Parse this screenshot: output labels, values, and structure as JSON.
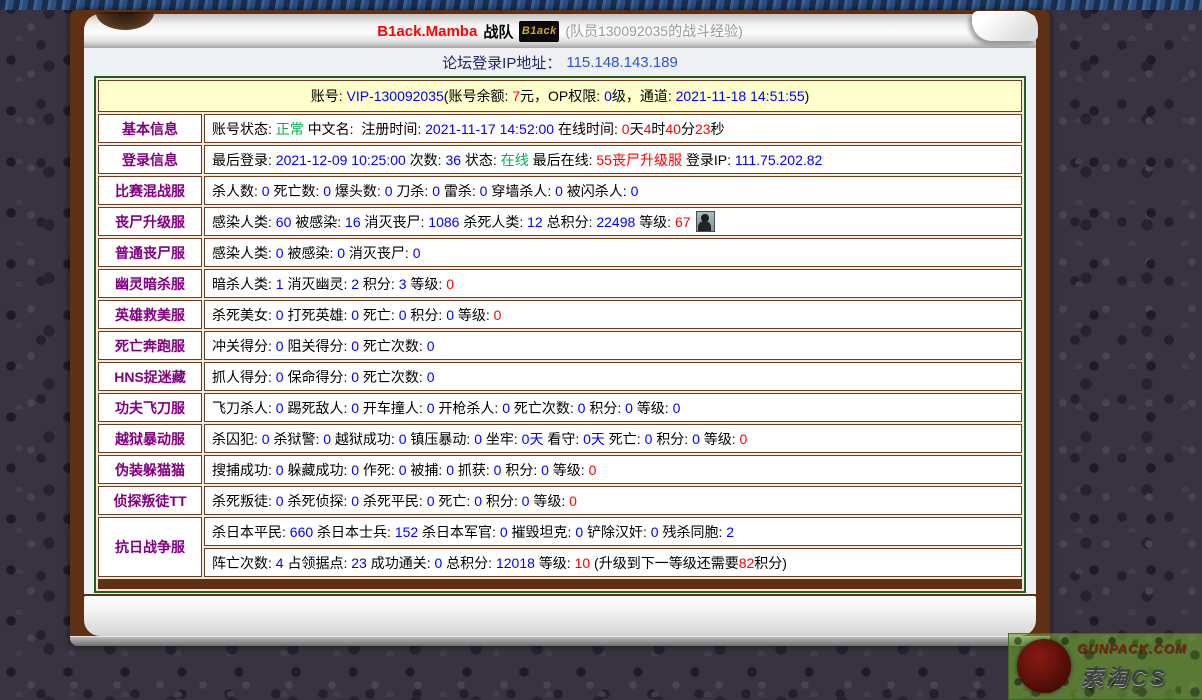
{
  "palette": {
    "k": "#000000",
    "b": "#0000ff",
    "r": "#ff0000",
    "g": "#00b050",
    "label_purple": "#800080",
    "banner_bg": "#ffffcc",
    "table_border_green": "#215e21",
    "cell_border_brown": "#6d3b21",
    "frame_brown": "#5f3013"
  },
  "header": {
    "team": "B1ack.Mamba",
    "team_suffix": "战队",
    "logo_text": "B1ack",
    "note": "(队员130092035的战斗经验)"
  },
  "ip_line": {
    "label": "论坛登录IP地址：",
    "value": "115.148.143.189"
  },
  "account_banner": [
    {
      "t": "账号: ",
      "c": "k"
    },
    {
      "t": "VIP-130092035",
      "c": "b"
    },
    {
      "t": "(账号余额: ",
      "c": "k"
    },
    {
      "t": "7",
      "c": "r"
    },
    {
      "t": "元，OP权限: ",
      "c": "k"
    },
    {
      "t": "0",
      "c": "b"
    },
    {
      "t": "级，通道: ",
      "c": "k"
    },
    {
      "t": "2021-11-18 14:51:55",
      "c": "b"
    },
    {
      "t": ")",
      "c": "k"
    }
  ],
  "table": {
    "rows": [
      {
        "label": "基本信息",
        "lines": [
          [
            {
              "t": "账号状态: ",
              "c": "k"
            },
            {
              "t": "正常",
              "c": "g"
            },
            {
              "t": " 中文名:  注册时间: ",
              "c": "k"
            },
            {
              "t": "2021-11-17 14:52:00",
              "c": "b"
            },
            {
              "t": " 在线时间: ",
              "c": "k"
            },
            {
              "t": "0",
              "c": "r"
            },
            {
              "t": "天",
              "c": "k"
            },
            {
              "t": "4",
              "c": "r"
            },
            {
              "t": "时",
              "c": "k"
            },
            {
              "t": "40",
              "c": "r"
            },
            {
              "t": "分",
              "c": "k"
            },
            {
              "t": "23",
              "c": "r"
            },
            {
              "t": "秒",
              "c": "k"
            }
          ]
        ]
      },
      {
        "label": "登录信息",
        "lines": [
          [
            {
              "t": "最后登录: ",
              "c": "k"
            },
            {
              "t": "2021-12-09 10:25:00",
              "c": "b"
            },
            {
              "t": " 次数: ",
              "c": "k"
            },
            {
              "t": "36",
              "c": "b"
            },
            {
              "t": " 状态: ",
              "c": "k"
            },
            {
              "t": "在线",
              "c": "g"
            },
            {
              "t": " 最后在线: ",
              "c": "k"
            },
            {
              "t": "55丧尸升级服",
              "c": "r"
            },
            {
              "t": " 登录IP: ",
              "c": "k"
            },
            {
              "t": "111.75.202.82",
              "c": "b"
            }
          ]
        ]
      },
      {
        "label": "比赛混战服",
        "lines": [
          [
            {
              "t": "杀人数: ",
              "c": "k"
            },
            {
              "t": "0",
              "c": "b"
            },
            {
              "t": " 死亡数: ",
              "c": "k"
            },
            {
              "t": "0",
              "c": "b"
            },
            {
              "t": " 爆头数: ",
              "c": "k"
            },
            {
              "t": "0",
              "c": "b"
            },
            {
              "t": " 刀杀: ",
              "c": "k"
            },
            {
              "t": "0",
              "c": "b"
            },
            {
              "t": " 雷杀: ",
              "c": "k"
            },
            {
              "t": "0",
              "c": "b"
            },
            {
              "t": " 穿墙杀人: ",
              "c": "k"
            },
            {
              "t": "0",
              "c": "b"
            },
            {
              "t": " 被闪杀人: ",
              "c": "k"
            },
            {
              "t": "0",
              "c": "b"
            }
          ]
        ]
      },
      {
        "label": "丧尸升级服",
        "lines": [
          [
            {
              "t": "感染人类: ",
              "c": "k"
            },
            {
              "t": "60",
              "c": "b"
            },
            {
              "t": " 被感染: ",
              "c": "k"
            },
            {
              "t": "16",
              "c": "b"
            },
            {
              "t": " 消灭丧尸: ",
              "c": "k"
            },
            {
              "t": "1086",
              "c": "b"
            },
            {
              "t": " 杀死人类: ",
              "c": "k"
            },
            {
              "t": "12",
              "c": "b"
            },
            {
              "t": " 总积分: ",
              "c": "k"
            },
            {
              "t": "22498",
              "c": "b"
            },
            {
              "t": " 等级: ",
              "c": "k"
            },
            {
              "t": "67",
              "c": "r"
            },
            {
              "icon": "level-avatar-icon"
            }
          ]
        ]
      },
      {
        "label": "普通丧尸服",
        "lines": [
          [
            {
              "t": "感染人类: ",
              "c": "k"
            },
            {
              "t": "0",
              "c": "b"
            },
            {
              "t": " 被感染: ",
              "c": "k"
            },
            {
              "t": "0",
              "c": "b"
            },
            {
              "t": " 消灭丧尸: ",
              "c": "k"
            },
            {
              "t": "0",
              "c": "b"
            }
          ]
        ]
      },
      {
        "label": "幽灵暗杀服",
        "lines": [
          [
            {
              "t": "暗杀人类: ",
              "c": "k"
            },
            {
              "t": "1",
              "c": "b"
            },
            {
              "t": " 消灭幽灵: ",
              "c": "k"
            },
            {
              "t": "2",
              "c": "b"
            },
            {
              "t": " 积分: ",
              "c": "k"
            },
            {
              "t": "3",
              "c": "b"
            },
            {
              "t": " 等级: ",
              "c": "k"
            },
            {
              "t": "0",
              "c": "r"
            }
          ]
        ]
      },
      {
        "label": "英雄救美服",
        "lines": [
          [
            {
              "t": "杀死美女: ",
              "c": "k"
            },
            {
              "t": "0",
              "c": "b"
            },
            {
              "t": " 打死英雄: ",
              "c": "k"
            },
            {
              "t": "0",
              "c": "b"
            },
            {
              "t": " 死亡: ",
              "c": "k"
            },
            {
              "t": "0",
              "c": "b"
            },
            {
              "t": " 积分: ",
              "c": "k"
            },
            {
              "t": "0",
              "c": "b"
            },
            {
              "t": " 等级: ",
              "c": "k"
            },
            {
              "t": "0",
              "c": "r"
            }
          ]
        ]
      },
      {
        "label": "死亡奔跑服",
        "lines": [
          [
            {
              "t": "冲关得分: ",
              "c": "k"
            },
            {
              "t": "0",
              "c": "b"
            },
            {
              "t": " 阻关得分: ",
              "c": "k"
            },
            {
              "t": "0",
              "c": "b"
            },
            {
              "t": " 死亡次数: ",
              "c": "k"
            },
            {
              "t": "0",
              "c": "b"
            }
          ]
        ]
      },
      {
        "label": "HNS捉迷藏",
        "lines": [
          [
            {
              "t": "抓人得分: ",
              "c": "k"
            },
            {
              "t": "0",
              "c": "b"
            },
            {
              "t": " 保命得分: ",
              "c": "k"
            },
            {
              "t": "0",
              "c": "b"
            },
            {
              "t": " 死亡次数: ",
              "c": "k"
            },
            {
              "t": "0",
              "c": "b"
            }
          ]
        ]
      },
      {
        "label": "功夫飞刀服",
        "lines": [
          [
            {
              "t": "飞刀杀人: ",
              "c": "k"
            },
            {
              "t": "0",
              "c": "b"
            },
            {
              "t": " 踢死敌人: ",
              "c": "k"
            },
            {
              "t": "0",
              "c": "b"
            },
            {
              "t": " 开车撞人: ",
              "c": "k"
            },
            {
              "t": "0",
              "c": "b"
            },
            {
              "t": " 开枪杀人: ",
              "c": "k"
            },
            {
              "t": "0",
              "c": "b"
            },
            {
              "t": " 死亡次数: ",
              "c": "k"
            },
            {
              "t": "0",
              "c": "b"
            },
            {
              "t": " 积分: ",
              "c": "k"
            },
            {
              "t": "0",
              "c": "b"
            },
            {
              "t": " 等级: ",
              "c": "k"
            },
            {
              "t": "0",
              "c": "b"
            }
          ]
        ]
      },
      {
        "label": "越狱暴动服",
        "lines": [
          [
            {
              "t": "杀囚犯: ",
              "c": "k"
            },
            {
              "t": "0",
              "c": "b"
            },
            {
              "t": " 杀狱警: ",
              "c": "k"
            },
            {
              "t": "0",
              "c": "b"
            },
            {
              "t": " 越狱成功: ",
              "c": "k"
            },
            {
              "t": "0",
              "c": "b"
            },
            {
              "t": " 镇压暴动: ",
              "c": "k"
            },
            {
              "t": "0",
              "c": "b"
            },
            {
              "t": " 坐牢: ",
              "c": "k"
            },
            {
              "t": "0天",
              "c": "b"
            },
            {
              "t": " 看守: ",
              "c": "k"
            },
            {
              "t": "0天",
              "c": "b"
            },
            {
              "t": " 死亡: ",
              "c": "k"
            },
            {
              "t": "0",
              "c": "b"
            },
            {
              "t": " 积分: ",
              "c": "k"
            },
            {
              "t": "0",
              "c": "b"
            },
            {
              "t": " 等级: ",
              "c": "k"
            },
            {
              "t": "0",
              "c": "r"
            }
          ]
        ]
      },
      {
        "label": "伪装躲猫猫",
        "lines": [
          [
            {
              "t": "搜捕成功: ",
              "c": "k"
            },
            {
              "t": "0",
              "c": "b"
            },
            {
              "t": " 躲藏成功: ",
              "c": "k"
            },
            {
              "t": "0",
              "c": "b"
            },
            {
              "t": " 作死: ",
              "c": "k"
            },
            {
              "t": "0",
              "c": "b"
            },
            {
              "t": " 被捕: ",
              "c": "k"
            },
            {
              "t": "0",
              "c": "b"
            },
            {
              "t": " 抓获: ",
              "c": "k"
            },
            {
              "t": "0",
              "c": "b"
            },
            {
              "t": " 积分: ",
              "c": "k"
            },
            {
              "t": "0",
              "c": "b"
            },
            {
              "t": " 等级: ",
              "c": "k"
            },
            {
              "t": "0",
              "c": "r"
            }
          ]
        ]
      },
      {
        "label": "侦探叛徒TT",
        "lines": [
          [
            {
              "t": "杀死叛徒: ",
              "c": "k"
            },
            {
              "t": "0",
              "c": "b"
            },
            {
              "t": " 杀死侦探: ",
              "c": "k"
            },
            {
              "t": "0",
              "c": "b"
            },
            {
              "t": " 杀死平民: ",
              "c": "k"
            },
            {
              "t": "0",
              "c": "b"
            },
            {
              "t": " 死亡: ",
              "c": "k"
            },
            {
              "t": "0",
              "c": "b"
            },
            {
              "t": " 积分: ",
              "c": "k"
            },
            {
              "t": "0",
              "c": "b"
            },
            {
              "t": " 等级: ",
              "c": "k"
            },
            {
              "t": "0",
              "c": "r"
            }
          ]
        ]
      },
      {
        "label": "抗日战争服",
        "lines": [
          [
            {
              "t": "杀日本平民: ",
              "c": "k"
            },
            {
              "t": "660",
              "c": "b"
            },
            {
              "t": " 杀日本士兵: ",
              "c": "k"
            },
            {
              "t": "152",
              "c": "b"
            },
            {
              "t": " 杀日本军官: ",
              "c": "k"
            },
            {
              "t": "0",
              "c": "b"
            },
            {
              "t": " 摧毁坦克: ",
              "c": "k"
            },
            {
              "t": "0",
              "c": "b"
            },
            {
              "t": " 铲除汉奸: ",
              "c": "k"
            },
            {
              "t": "0",
              "c": "b"
            },
            {
              "t": " 残杀同胞: ",
              "c": "k"
            },
            {
              "t": "2",
              "c": "b"
            }
          ],
          [
            {
              "t": "阵亡次数: ",
              "c": "k"
            },
            {
              "t": "4",
              "c": "b"
            },
            {
              "t": " 占领据点: ",
              "c": "k"
            },
            {
              "t": "23",
              "c": "b"
            },
            {
              "t": " 成功通关: ",
              "c": "k"
            },
            {
              "t": "0",
              "c": "b"
            },
            {
              "t": " 总积分: ",
              "c": "k"
            },
            {
              "t": "12018",
              "c": "b"
            },
            {
              "t": " 等级: ",
              "c": "k"
            },
            {
              "t": "10",
              "c": "r"
            },
            {
              "t": " (升级到下一等级还需要",
              "c": "k"
            },
            {
              "t": "82",
              "c": "r"
            },
            {
              "t": "积分)",
              "c": "k"
            }
          ]
        ]
      }
    ]
  },
  "watermark": {
    "site": "GUNPACK.COM",
    "brand": "索淘CS"
  }
}
